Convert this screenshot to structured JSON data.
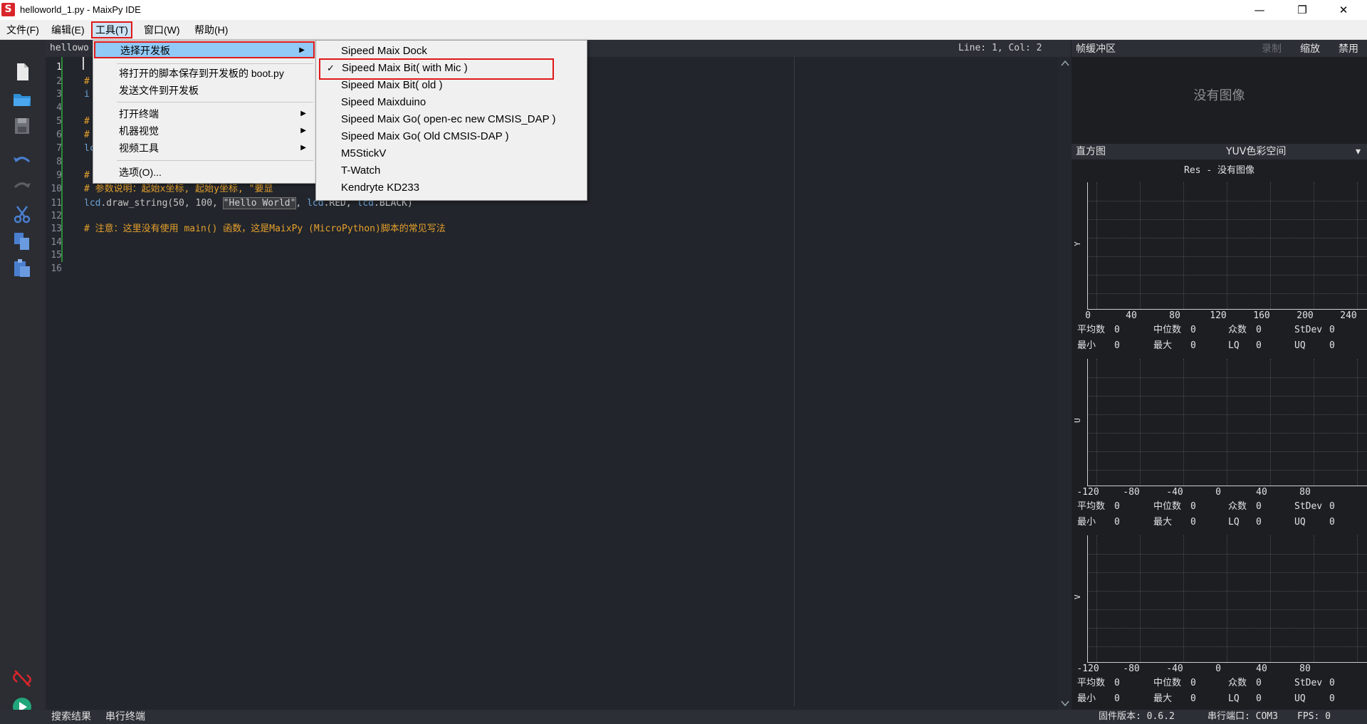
{
  "window": {
    "title": "helloworld_1.py - MaixPy IDE",
    "logo_letter": "S",
    "minimize_icon": "—",
    "restore_icon": "❐",
    "close_icon": "✕"
  },
  "menubar": {
    "file": "文件(F)",
    "edit": "编辑(E)",
    "tools": "工具(T)",
    "window": "窗口(W)",
    "help": "帮助(H)"
  },
  "editor": {
    "tab": "hellowo",
    "cursor_pos": "Line: 1, Col: 2",
    "line_numbers": [
      "1",
      "2",
      "3",
      "4",
      "5",
      "6",
      "7",
      "8",
      "9",
      "10",
      "11",
      "12",
      "13",
      "14",
      "15",
      "16"
    ],
    "visible_code": {
      "l2": "#",
      "l3": "i",
      "l5": "#",
      "l6": "#",
      "l7": "lc",
      "l9": "#",
      "l10": "# 参数说明：起始x坐标, 起始y坐标, \"要显",
      "l11_fn": "lcd",
      "l11_call": ".draw_string(50, 100, ",
      "l11_str": "\"Hello World\"",
      "l11_args_a": ", ",
      "l11_lcd2": "lcd",
      "l11_red": ".RED, ",
      "l11_lcd3": "lcd",
      "l11_black": ".BLACK)",
      "l13": "# 注意：这里没有使用 main() 函数，这是MaixPy (MicroPython)脚本的常见写法"
    }
  },
  "tools_menu": {
    "items": [
      {
        "label": "选择开发板",
        "submenu": true
      },
      {
        "label": "将打开的脚本保存到开发板的 boot.py"
      },
      {
        "label": "发送文件到开发板"
      },
      {
        "label": "打开终端",
        "submenu": true
      },
      {
        "label": "机器视觉",
        "submenu": true
      },
      {
        "label": "视频工具",
        "submenu": true
      },
      {
        "label": "选项(O)..."
      }
    ],
    "submenu_arrow": "▶"
  },
  "board_menu": {
    "check_mark": "✓",
    "items": [
      {
        "label": "Sipeed Maix Dock"
      },
      {
        "label": "Sipeed Maix Bit( with Mic )",
        "checked": true
      },
      {
        "label": "Sipeed Maix Bit( old )"
      },
      {
        "label": "Sipeed Maixduino"
      },
      {
        "label": "Sipeed Maix Go( open-ec  new CMSIS_DAP )"
      },
      {
        "label": "Sipeed Maix Go( Old CMSIS-DAP )"
      },
      {
        "label": "M5StickV"
      },
      {
        "label": "T-Watch"
      },
      {
        "label": "Kendryte KD233"
      }
    ]
  },
  "frame_buffer": {
    "title": "帧缓冲区",
    "record": "录制",
    "zoom": "缩放",
    "disable": "禁用",
    "no_image": "没有图像"
  },
  "histogram": {
    "title": "直方图",
    "colorspace": "YUV色彩空间",
    "dropdown_icon": "▾",
    "res_label": "Res - 没有图像",
    "channels": [
      {
        "axis": "Y",
        "ticks": [
          "0",
          "40",
          "80",
          "120",
          "160",
          "200",
          "240"
        ]
      },
      {
        "axis": "U",
        "ticks": [
          "-120",
          "-80",
          "-40",
          "0",
          "40",
          "80"
        ]
      },
      {
        "axis": "V",
        "ticks": [
          "-120",
          "-80",
          "-40",
          "0",
          "40",
          "80"
        ]
      }
    ],
    "stats": {
      "mean": "平均数",
      "median": "中位数",
      "mode": "众数",
      "stdev": "StDev",
      "min": "最小",
      "max": "最大",
      "lq": "LQ",
      "uq": "UQ",
      "zero": "0"
    }
  },
  "statusbar": {
    "search_results": "搜索结果",
    "serial_terminal": "串行终端",
    "firmware": "固件版本: 0.6.2",
    "serial_port": "串行端口: COM3",
    "fps": "FPS: 0"
  },
  "colors": {
    "editor_bg": "#22252b",
    "comment": "#e5a02d",
    "keyword": "#6ba3d7",
    "highlight_box": "#e01818",
    "menu_highlight": "#91c9f7"
  }
}
